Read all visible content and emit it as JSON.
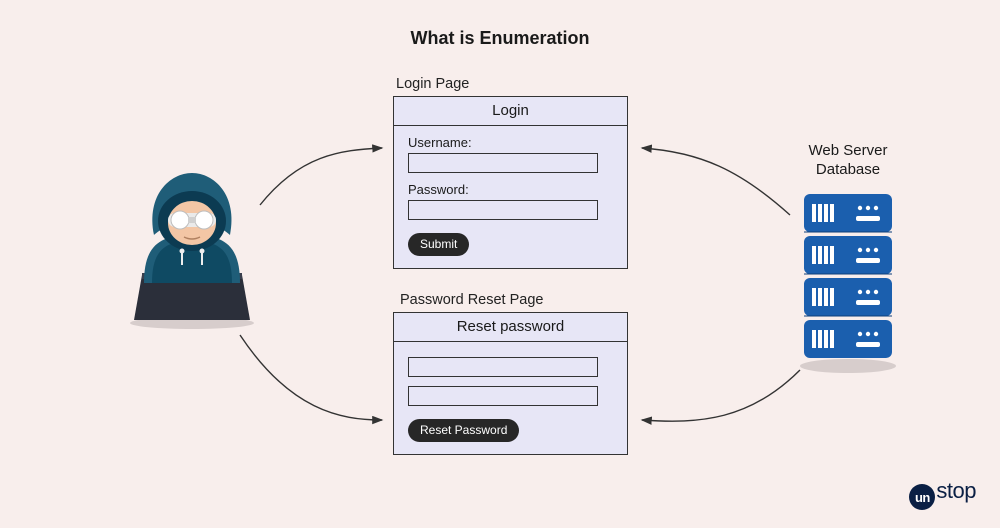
{
  "title": "What is Enumeration",
  "login": {
    "panel_label": "Login Page",
    "header": "Login",
    "username_label": "Username:",
    "password_label": "Password:",
    "submit_label": "Submit"
  },
  "reset": {
    "panel_label": "Password Reset Page",
    "header": "Reset password",
    "button_label": "Reset Password"
  },
  "server": {
    "label": "Web Server Database"
  },
  "brand": {
    "circle_text": "un",
    "rest_text": "stop"
  }
}
